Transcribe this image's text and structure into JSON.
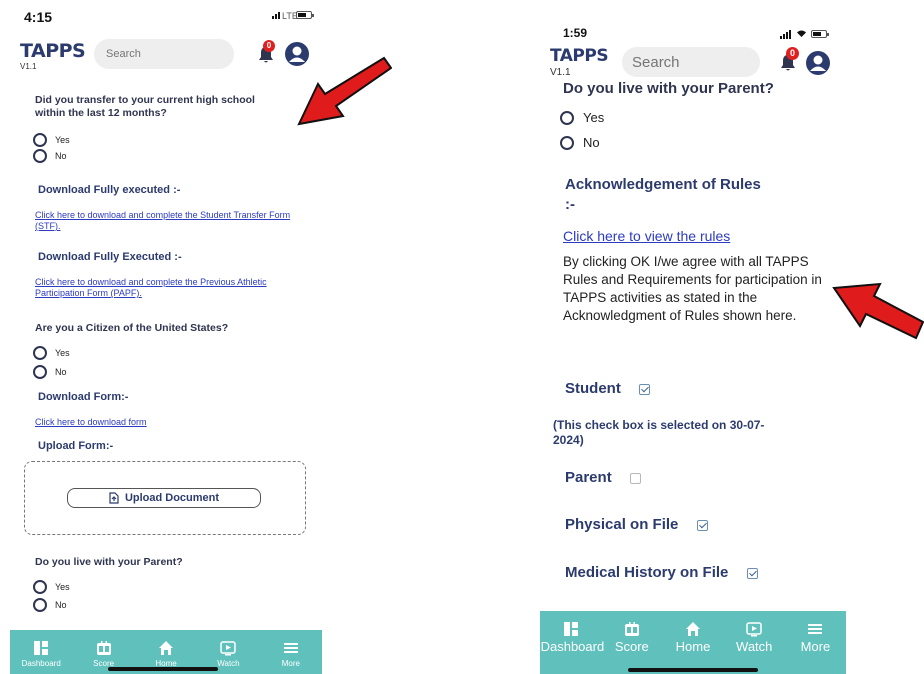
{
  "left": {
    "status": {
      "time": "4:15",
      "network": "LTE"
    },
    "header": {
      "logo": "TAPPS",
      "version": "V1.1",
      "search_placeholder": "Search",
      "notifications": "0"
    },
    "q_transfer": "Did you transfer to your current high school within the last 12 months?",
    "q_transfer_options": [
      "Yes",
      "No"
    ],
    "download_executed_1": "Download Fully executed :-",
    "link_stf": "Click here to download and complete the Student Transfer Form (STF).",
    "download_executed_2": "Download Fully Executed :-",
    "link_papf": "Click here to download and complete the Previous Athletic Participation Form (PAPF).",
    "q_citizen": "Are you a Citizen of the United States?",
    "q_citizen_options": [
      "Yes",
      "No"
    ],
    "download_form": "Download Form:-",
    "link_form": "Click here to download form",
    "upload_form": "Upload Form:-",
    "upload_button": "Upload Document",
    "q_parent": "Do you live with your Parent?",
    "q_parent_options": [
      "Yes",
      "No"
    ],
    "tabs": [
      "Dashboard",
      "Score",
      "Home",
      "Watch",
      "More"
    ]
  },
  "right": {
    "status": {
      "time": "1:59"
    },
    "header": {
      "logo": "TAPPS",
      "version": "V1.1",
      "search_placeholder": "Search",
      "notifications": "0"
    },
    "q_parent": "Do you live with your Parent?",
    "q_parent_options": [
      "Yes",
      "No"
    ],
    "ack_title": "Acknowledgement of Rules :-",
    "link_rules": "Click here to view the rules",
    "ack_text": "By clicking OK I/we agree with all TAPPS Rules and Requirements for participation in TAPPS activities as stated in the Acknowledgment of Rules shown here.",
    "student_label": "Student",
    "student_note": "(This check box is selected on 30-07-2024)",
    "parent_label": "Parent",
    "physical_label": "Physical on File",
    "medical_label": "Medical History on File",
    "tabs": [
      "Dashboard",
      "Score",
      "Home",
      "Watch",
      "More"
    ]
  },
  "colors": {
    "accent": "#5fc0bc",
    "heading": "#2c3b6e",
    "link": "#2c3bc0",
    "badge": "#e02020",
    "arrow": "#e01b1b"
  }
}
